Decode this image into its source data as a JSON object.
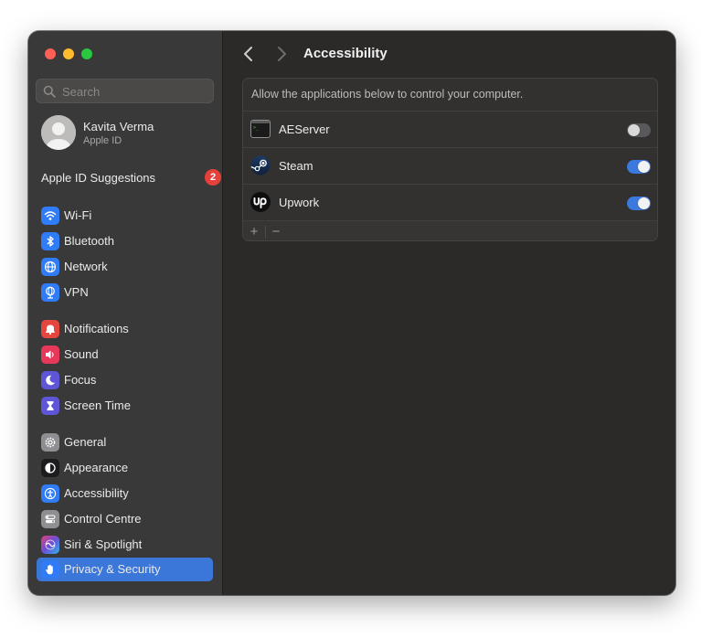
{
  "search": {
    "placeholder": "Search"
  },
  "profile": {
    "name": "Kavita Verma",
    "subtitle": "Apple ID"
  },
  "suggestions": {
    "label": "Apple ID Suggestions",
    "badge": "2"
  },
  "sidebar": {
    "items": [
      {
        "label": "Wi-Fi",
        "icon": "wifi-icon",
        "color": "#2f7cf6"
      },
      {
        "label": "Bluetooth",
        "icon": "bluetooth-icon",
        "color": "#2f7cf6"
      },
      {
        "label": "Network",
        "icon": "globe-icon",
        "color": "#2f7cf6"
      },
      {
        "label": "VPN",
        "icon": "vpn-globe-icon",
        "color": "#2f7cf6"
      },
      {
        "label": "Notifications",
        "icon": "bell-icon",
        "color": "#e5473f"
      },
      {
        "label": "Sound",
        "icon": "speaker-icon",
        "color": "#e8385a"
      },
      {
        "label": "Focus",
        "icon": "moon-icon",
        "color": "#5e56d6"
      },
      {
        "label": "Screen Time",
        "icon": "hourglass-icon",
        "color": "#5e56d6"
      },
      {
        "label": "General",
        "icon": "gear-icon",
        "color": "#8e8e93"
      },
      {
        "label": "Appearance",
        "icon": "appearance-icon",
        "color": "#1c1c1e"
      },
      {
        "label": "Accessibility",
        "icon": "accessibility-icon",
        "color": "#2f7cf6"
      },
      {
        "label": "Control Centre",
        "icon": "control-centre-icon",
        "color": "#8e8e93"
      },
      {
        "label": "Siri & Spotlight",
        "icon": "siri-icon",
        "color": "#6b4fd8"
      },
      {
        "label": "Privacy & Security",
        "icon": "hand-icon",
        "color": "#2f7cf6"
      }
    ],
    "active": "Privacy & Security"
  },
  "main": {
    "title": "Accessibility",
    "description": "Allow the applications below to control your computer.",
    "apps": [
      {
        "name": "AEServer",
        "icon": "terminal-icon",
        "enabled": false
      },
      {
        "name": "Steam",
        "icon": "steam-icon",
        "enabled": true
      },
      {
        "name": "Upwork",
        "icon": "upwork-icon",
        "enabled": true
      }
    ],
    "footer": {
      "add": "+",
      "remove": "−"
    }
  }
}
